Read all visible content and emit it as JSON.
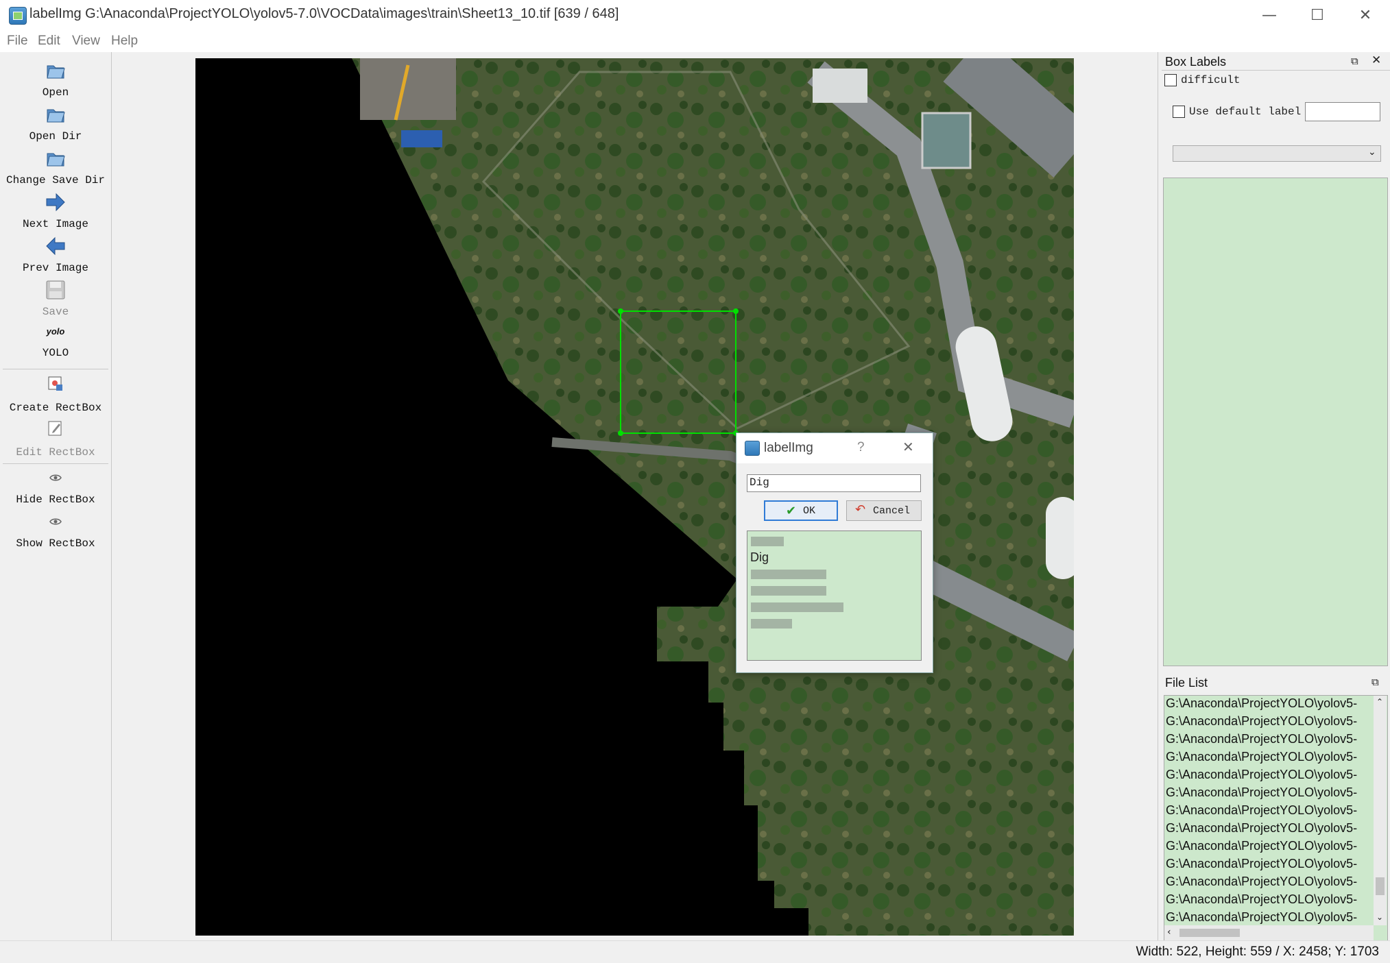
{
  "window": {
    "title": "labelImg G:\\Anaconda\\ProjectYOLO\\yolov5-7.0\\VOCData\\images\\train\\Sheet13_10.tif [639 / 648]",
    "minimize_glyph": "—",
    "maximize_glyph": "☐",
    "close_glyph": "✕"
  },
  "menu": [
    "File",
    "Edit",
    "View",
    "Help"
  ],
  "toolbar": {
    "open": "Open",
    "open_dir": "Open Dir",
    "change_save_dir": "Change Save Dir",
    "next_image": "Next Image",
    "prev_image": "Prev Image",
    "save": "Save",
    "format_icon_text": "yolo",
    "format": "YOLO",
    "create_rectbox": "Create RectBox",
    "edit_rectbox": "Edit RectBox",
    "hide_rectbox": "Hide RectBox",
    "show_rectbox": "Show RectBox"
  },
  "dialog": {
    "title": "labelImg",
    "help_glyph": "?",
    "close_glyph": "✕",
    "input_value": "Dig",
    "ok_label": "OK",
    "cancel_label": "Cancel",
    "label_list_visible_text": "Dig"
  },
  "box_labels": {
    "title": "Box Labels",
    "difficult": "difficult",
    "use_default_label": "Use default label",
    "default_label_value": "",
    "combo_value": ""
  },
  "file_list": {
    "title": "File List",
    "items": [
      "G:\\Anaconda\\ProjectYOLO\\yolov5-",
      "G:\\Anaconda\\ProjectYOLO\\yolov5-",
      "G:\\Anaconda\\ProjectYOLO\\yolov5-",
      "G:\\Anaconda\\ProjectYOLO\\yolov5-",
      "G:\\Anaconda\\ProjectYOLO\\yolov5-",
      "G:\\Anaconda\\ProjectYOLO\\yolov5-",
      "G:\\Anaconda\\ProjectYOLO\\yolov5-",
      "G:\\Anaconda\\ProjectYOLO\\yolov5-",
      "G:\\Anaconda\\ProjectYOLO\\yolov5-",
      "G:\\Anaconda\\ProjectYOLO\\yolov5-",
      "G:\\Anaconda\\ProjectYOLO\\yolov5-",
      "G:\\Anaconda\\ProjectYOLO\\yolov5-",
      "G:\\Anaconda\\ProjectYOLO\\yolov5-"
    ]
  },
  "status": "Width: 522, Height: 559 / X: 2458; Y: 1703",
  "colors": {
    "annotation_box": "#00e000",
    "list_background": "#cde8cc",
    "ok_border": "#2f7bd6"
  }
}
